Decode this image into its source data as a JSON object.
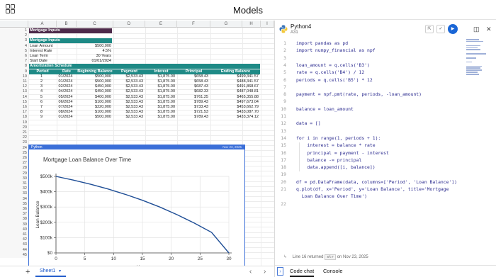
{
  "window": {
    "title": "Models"
  },
  "sheet": {
    "columns": [
      "A",
      "B",
      "C",
      "D",
      "E",
      "F",
      "G",
      "H",
      "I",
      "J"
    ],
    "rows": [
      "1",
      "2",
      "3",
      "4",
      "5",
      "6",
      "7",
      "8",
      "9",
      "10",
      "11",
      "12",
      "13",
      "14",
      "15",
      "16",
      "17",
      "18",
      "19",
      "20",
      "21",
      "22",
      "23",
      "24",
      "25",
      "26",
      "27",
      "28",
      "29",
      "30",
      "31",
      "32",
      "33",
      "34",
      "35",
      "36",
      "37",
      "38",
      "39",
      "40",
      "41",
      "42",
      "43",
      "44",
      "45"
    ],
    "mortgage_title": "Mortgage Inputs",
    "inputs_header": "Mortgage Inputs",
    "inputs": [
      {
        "label": "Loan Amount",
        "value": "$500,000"
      },
      {
        "label": "Interest Rate",
        "value": "4.5%"
      },
      {
        "label": "Loan Term",
        "value": "30 Years"
      },
      {
        "label": "Start Date",
        "value": "01/01/2024"
      }
    ],
    "amort_title": "Amortization Schedule",
    "amort_headers": [
      "Period",
      "Date",
      "Beginning Balance",
      "Payment",
      "Interest",
      "Principal",
      "Ending Balance"
    ],
    "amort_rows": [
      [
        "1",
        "01/2024",
        "$500,000",
        "$2,533.43",
        "$1,875.00",
        "$658.43",
        "$499,341.57"
      ],
      [
        "2",
        "01/2024",
        "$500,000",
        "$2,533.43",
        "$1,875.00",
        "$658.43",
        "$488,341.57"
      ],
      [
        "3",
        "02/2024",
        "$450,000",
        "$2,533.43",
        "$1,875.00",
        "$687.43",
        "$491,868.67"
      ],
      [
        "4",
        "04/2024",
        "$450,000",
        "$2,533.43",
        "$1,875.00",
        "$682.33",
        "$487,048.81"
      ],
      [
        "5",
        "05/2024",
        "$400,000",
        "$2,533.43",
        "$1,875.00",
        "$761.25",
        "$465,355.88"
      ],
      [
        "6",
        "06/2024",
        "$100,000",
        "$2,533.43",
        "$1,875.00",
        "$789.43",
        "$497,673.04"
      ],
      [
        "7",
        "07/2024",
        "$220,000",
        "$2,533.43",
        "$1,875.00",
        "$733.43",
        "$453,662.79"
      ],
      [
        "8",
        "08/2024",
        "$100,000",
        "$2,533.43",
        "$1,875.00",
        "$721.53",
        "$433,087.70"
      ],
      [
        "9",
        "01/2024",
        "$500,000",
        "$2,533.43",
        "$1,875.00",
        "$789.43",
        "$433,374.12"
      ]
    ],
    "python_object_label": "Python",
    "python_object_time": "Nov 23, 2025"
  },
  "chart_data": {
    "type": "line",
    "title": "Mortgage Loan Balance Over Time",
    "xlabel": "Years",
    "ylabel": "Loan Balance",
    "xlim": [
      0,
      30
    ],
    "ylim": [
      0,
      500000
    ],
    "x_ticks": [
      "0",
      "5",
      "10",
      "15",
      "20",
      "25",
      "30"
    ],
    "y_ticks": [
      "$0",
      "$100k",
      "$200k",
      "$300k",
      "$400k",
      "$500k"
    ],
    "grid": true,
    "x": [
      0,
      3,
      6,
      9,
      12,
      15,
      18,
      21,
      24,
      27,
      30
    ],
    "values": [
      500000,
      476000,
      449000,
      418000,
      383000,
      344000,
      300000,
      250000,
      195000,
      134000,
      0
    ],
    "color": "#1f4e96"
  },
  "sheet_tabs": {
    "add": "+",
    "active": "Sheet1",
    "prev": "‹",
    "next": "›"
  },
  "python_panel": {
    "name": "Python4",
    "cell": "A31",
    "lines": [
      {
        "n": "1",
        "t": "import pandas as pd"
      },
      {
        "n": "2",
        "t": "import numpy_financial as npf"
      },
      {
        "n": "3",
        "t": ""
      },
      {
        "n": "4",
        "t": "loan_amount = q.cells('B3')"
      },
      {
        "n": "5",
        "t": "rate = q.cells('B4') / 12"
      },
      {
        "n": "6",
        "t": "periods = q.cells('B5') * 12"
      },
      {
        "n": "7",
        "t": ""
      },
      {
        "n": "8",
        "t": "payment = npf.pmt(rate, periods, -loan_amount)"
      },
      {
        "n": "9",
        "t": ""
      },
      {
        "n": "10",
        "t": "balance = loan_amount"
      },
      {
        "n": "11",
        "t": ""
      },
      {
        "n": "12",
        "t": "data = []"
      },
      {
        "n": "13",
        "t": ""
      },
      {
        "n": "14",
        "t": "for i in range(1, periods + 1):"
      },
      {
        "n": "15",
        "t": "    interest = balance * rate"
      },
      {
        "n": "16",
        "t": "    principal = payment - interest"
      },
      {
        "n": "17",
        "t": "    balance -= principal"
      },
      {
        "n": "18",
        "t": "    data.append([i, balance])"
      },
      {
        "n": "19",
        "t": ""
      },
      {
        "n": "20",
        "t": "df = pd.DataFrame(data, columns=['Period', 'Loan Balance'])"
      },
      {
        "n": "21",
        "t": "q.plot(df, x='Period', y='Loan Balance', title='Mortgage"
      },
      {
        "n": "",
        "t": "  Loan Balance Over Time')"
      },
      {
        "n": "22",
        "t": ""
      }
    ],
    "status_prefix": "Line 16 returned",
    "status_type": "str",
    "status_suffix": "on Nov 23, 2025",
    "tabs": [
      "Code chat",
      "Console"
    ],
    "active_tab": "Code chat",
    "colors": {
      "run": "#1a66d6",
      "accent": "#3b6fd8",
      "band": "#4d2a4a",
      "teal": "#1e8a86"
    }
  }
}
